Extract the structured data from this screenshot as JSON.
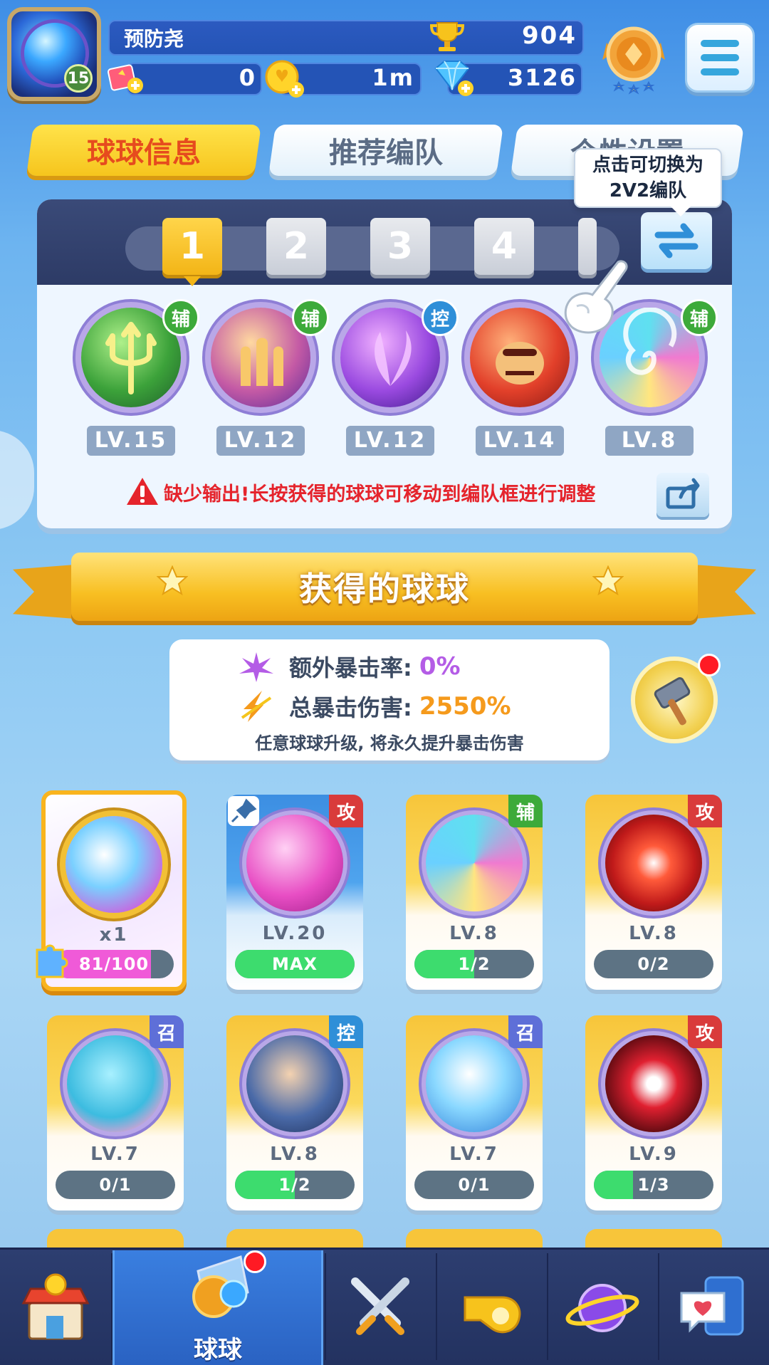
{
  "player": {
    "name": "预防尧",
    "level": "15",
    "trophies": "904",
    "tickets": "0",
    "coin_timer": "1m",
    "gems": "3126"
  },
  "tabs": [
    {
      "label": "球球信息",
      "active": true
    },
    {
      "label": "推荐编队",
      "active": false
    },
    {
      "label": "个性设置",
      "active": false
    }
  ],
  "tooltip": {
    "line1": "点击可切换为",
    "line2": "2V2编队"
  },
  "team": {
    "slots": [
      "1",
      "2",
      "3",
      "4"
    ],
    "active_slot": "1",
    "balls": [
      {
        "role": "辅",
        "level": "LV.15",
        "icon": "trident-ball-icon"
      },
      {
        "role": "辅",
        "level": "LV.12",
        "icon": "figures-ball-icon"
      },
      {
        "role": "控",
        "level": "LV.12",
        "icon": "butterfly-ball-icon"
      },
      {
        "role": "",
        "level": "LV.14",
        "icon": "gorilla-ball-icon"
      },
      {
        "role": "辅",
        "level": "LV.8",
        "icon": "swirl-ball-icon"
      }
    ],
    "warning": "缺少输出!长按获得的球球可移动到编队框进行调整"
  },
  "obtained": {
    "title": "获得的球球",
    "extra_crit_label": "额外暴击率:",
    "extra_crit_value": "0%",
    "total_crit_label": "总暴击伤害:",
    "total_crit_value": "2550%",
    "note": "任意球球升级, 将永久提升暴击伤害"
  },
  "cards": [
    {
      "type": "special",
      "count": "x1",
      "progress": "81/100",
      "progress_fraction": 0.81,
      "icon": "dragon-ring-icon"
    },
    {
      "role": "攻",
      "level": "LV.20",
      "progress": "MAX",
      "progress_fraction": 1.0,
      "icon": "pink-shield-ball-icon",
      "pinned": true
    },
    {
      "role": "辅",
      "level": "LV.8",
      "progress": "1/2",
      "progress_fraction": 0.5,
      "icon": "swirl-ball-icon"
    },
    {
      "role": "攻",
      "level": "LV.8",
      "progress": "0/2",
      "progress_fraction": 0.0,
      "icon": "red-burst-ball-icon"
    },
    {
      "role": "召",
      "level": "LV.7",
      "progress": "0/1",
      "progress_fraction": 0.0,
      "icon": "blue-monster-ball-icon"
    },
    {
      "role": "控",
      "level": "LV.8",
      "progress": "1/2",
      "progress_fraction": 0.5,
      "icon": "warrior-ball-icon"
    },
    {
      "role": "召",
      "level": "LV.7",
      "progress": "0/1",
      "progress_fraction": 0.0,
      "icon": "wing-ball-icon"
    },
    {
      "role": "攻",
      "level": "LV.9",
      "progress": "1/3",
      "progress_fraction": 0.33,
      "icon": "venom-ball-icon"
    }
  ],
  "nav": {
    "items": [
      "shop",
      "balls",
      "battle",
      "whistle",
      "planet",
      "chat"
    ],
    "active_label": "球球"
  },
  "colors": {
    "accent_yellow": "#f6c51d",
    "warning_red": "#e5242c",
    "progress_green": "#3ddc6e",
    "crit_purple": "#b45ce6",
    "crit_orange": "#f59a1c"
  }
}
